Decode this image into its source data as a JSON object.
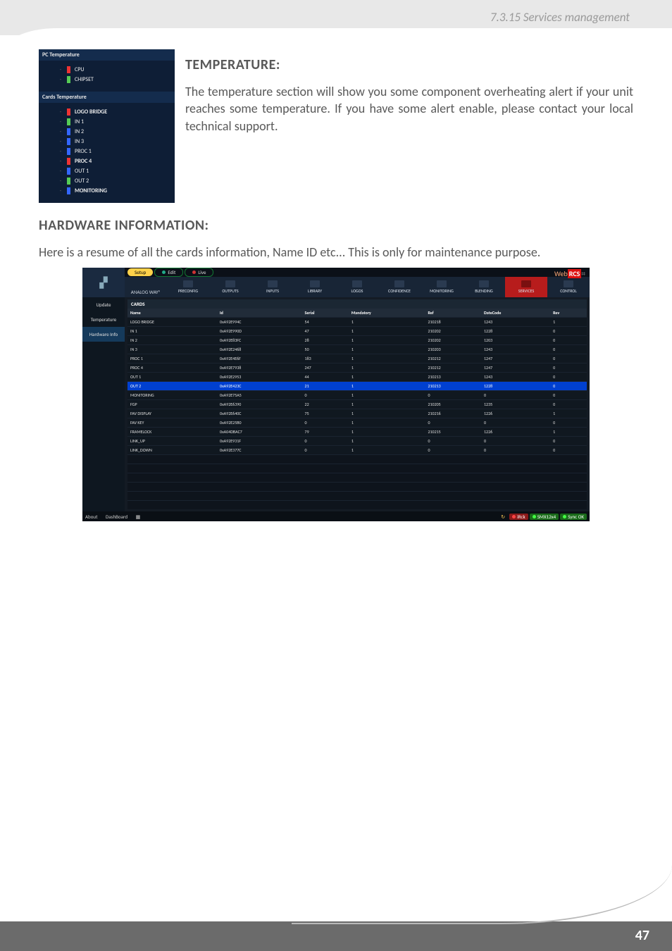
{
  "header": {
    "breadcrumb": "7.3.15 Services management"
  },
  "page": {
    "number": "47"
  },
  "temperature": {
    "heading": "TEMPERATURE:",
    "body": "The temperature section will show you some component overheating alert if your unit reaches some temperature. If you have some alert enable, please contact your local technical support."
  },
  "hardware": {
    "heading": "HARDWARE INFORMATION:",
    "body": "Here is a resume of all the cards information, Name ID etc... This is only for maintenance purpose."
  },
  "temp_panel": {
    "section1": "PC Temperature",
    "section2": "Cards Temperature",
    "pc": [
      {
        "color": "red",
        "label": "CPU"
      },
      {
        "color": "green",
        "label": "CHIPSET"
      }
    ],
    "cards": [
      {
        "color": "red",
        "label": "LOGO BRIDGE",
        "bold": true
      },
      {
        "color": "green",
        "label": "IN 1"
      },
      {
        "color": "blue",
        "label": "IN 2"
      },
      {
        "color": "blue",
        "label": "IN 3"
      },
      {
        "color": "blue",
        "label": "PROC 1"
      },
      {
        "color": "red",
        "label": "PROC 4",
        "bold": true
      },
      {
        "color": "blue",
        "label": "OUT 1"
      },
      {
        "color": "green",
        "label": "OUT 2"
      },
      {
        "color": "blue",
        "label": "MONITORING",
        "bold": true
      }
    ]
  },
  "app": {
    "tabs": {
      "setup": "Setup",
      "edit": "Edit",
      "live": "Live"
    },
    "brand": {
      "web": "Web",
      "rcs": "RCS",
      "suffix": "⌗"
    },
    "logo_text": "ANALOG WAY®",
    "nav": [
      "PRECONFIG",
      "OUTPUTS",
      "INPUTS",
      "LIBRARY",
      "LOGOS",
      "CONFIDENCE",
      "MONITORING",
      "BLENDING",
      "SERVICES",
      "CONTROL"
    ],
    "nav_active": 8,
    "side": [
      "Update",
      "Temperature",
      "Hardware Info"
    ],
    "side_active": 2,
    "cards_title": "CARDS",
    "columns": [
      "Name",
      "Id",
      "Serial",
      "Mandatory",
      "Ref",
      "DateCode",
      "Rev"
    ],
    "rows": [
      [
        "LOGO BRIDGE",
        "0xA92E994C",
        "54",
        "1",
        "210218",
        "1243",
        "1"
      ],
      [
        "IN 1",
        "0xA92E990D",
        "47",
        "1",
        "210202",
        "1228",
        "0"
      ],
      [
        "IN 2",
        "0xA92E83FC",
        "28",
        "1",
        "210202",
        "1203",
        "0"
      ],
      [
        "IN 3",
        "0xA92E2468",
        "50",
        "1",
        "210203",
        "1243",
        "0"
      ],
      [
        "PROC 1",
        "0xA92E4E6F",
        "183",
        "1",
        "210212",
        "1247",
        "0"
      ],
      [
        "PROC 4",
        "0xA92E7938",
        "247",
        "1",
        "210212",
        "1247",
        "0"
      ],
      [
        "OUT 1",
        "0xA92E2953",
        "44",
        "1",
        "210213",
        "1243",
        "0"
      ],
      [
        "OUT 2",
        "0xA92E423C",
        "21",
        "1",
        "210213",
        "1228",
        "0"
      ],
      [
        "MONITORING",
        "0xA92E75A5",
        "0",
        "1",
        "0",
        "0",
        "0"
      ],
      [
        "FGP",
        "0xA92E6390",
        "22",
        "1",
        "210205",
        "1235",
        "0"
      ],
      [
        "FAV DISPLAY",
        "0xA92E640C",
        "75",
        "1",
        "210216",
        "1226",
        "1"
      ],
      [
        "FAV KEY",
        "0xA92E25B0",
        "0",
        "1",
        "0",
        "0",
        "0"
      ],
      [
        "FRAMELOCK",
        "0xA04DBAC7",
        "79",
        "1",
        "210215",
        "1226",
        "1"
      ],
      [
        "LINK_UP",
        "0xA92E931F",
        "0",
        "1",
        "0",
        "0",
        "0"
      ],
      [
        "LINK_DOWN",
        "0xA92E377C",
        "0",
        "1",
        "0",
        "0",
        "0"
      ]
    ],
    "out2_row_index": 7,
    "footer": {
      "left": [
        "About",
        "DashBoard"
      ],
      "reload": "↻",
      "badges": [
        {
          "cls": "b-red",
          "text": "iRck"
        },
        {
          "cls": "b-grn",
          "text": "SMX12x4"
        },
        {
          "cls": "b-grn",
          "text": "Sync OK"
        }
      ]
    }
  }
}
